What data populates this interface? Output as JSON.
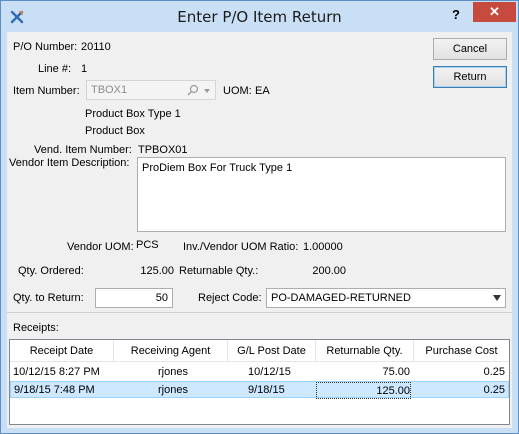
{
  "window": {
    "title": "Enter P/O Item Return"
  },
  "titlebar": {
    "help_label": "?",
    "close_label": "✕"
  },
  "buttons": {
    "cancel": "Cancel",
    "return": "Return"
  },
  "po": {
    "po_number_label": "P/O Number:",
    "po_number": "20110",
    "line_label": "Line #:",
    "line": "1"
  },
  "item": {
    "label": "Item Number:",
    "value": "TBOX1",
    "uom_label": "UOM:",
    "uom": "EA",
    "desc1": "Product Box Type 1",
    "desc2": "Product Box"
  },
  "vendor": {
    "item_number_label": "Vend. Item Number:",
    "item_number": "TPBOX01",
    "item_desc_label": "Vendor Item Description:",
    "item_desc": "ProDiem Box For Truck Type 1",
    "uom_label": "Vendor UOM:",
    "uom": "PCS",
    "ratio_label": "Inv./Vendor UOM Ratio:",
    "ratio": "1.00000"
  },
  "qty": {
    "ordered_label": "Qty. Ordered:",
    "ordered": "125.00",
    "returnable_label": "Returnable Qty.:",
    "returnable": "200.00",
    "to_return_label": "Qty. to Return:",
    "to_return": "50",
    "reject_label": "Reject Code:",
    "reject_code": "PO-DAMAGED-RETURNED"
  },
  "receipts": {
    "label": "Receipts:",
    "columns": [
      "Receipt Date",
      "Receiving Agent",
      "G/L Post Date",
      "Returnable Qty.",
      "Purchase Cost"
    ],
    "rows": [
      {
        "receipt_date": "10/12/15 8:27 PM",
        "agent": "rjones",
        "gl_date": "10/12/15",
        "qty": "75.00",
        "cost": "0.25"
      },
      {
        "receipt_date": "9/18/15 7:48 PM",
        "agent": "rjones",
        "gl_date": "9/18/15",
        "qty": "125.00",
        "cost": "0.25"
      }
    ]
  }
}
